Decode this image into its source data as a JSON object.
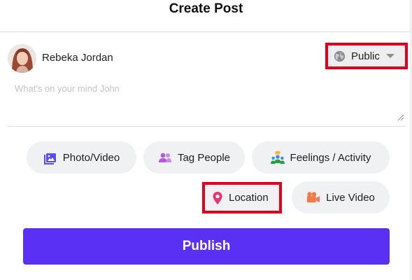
{
  "header": {
    "title": "Create Post"
  },
  "user": {
    "name": "Rebeka Jordan",
    "avatar_icon": "user-avatar"
  },
  "privacy": {
    "label": "Public",
    "icon": "globe-icon",
    "caret_icon": "caret-down-icon"
  },
  "composer": {
    "placeholder": "What's on your mind John",
    "value": ""
  },
  "actions": [
    {
      "label": "Photo/Video",
      "icon": "photo-video-icon",
      "color": "#5b4af5"
    },
    {
      "label": "Tag People",
      "icon": "tag-people-icon",
      "color": "#b45ad7"
    },
    {
      "label": "Feelings / Activity",
      "icon": "feelings-activity-icon",
      "color": "#2a9d4b"
    },
    {
      "label": "Location",
      "icon": "location-pin-icon",
      "color": "#e8336f"
    },
    {
      "label": "Live Video",
      "icon": "live-video-icon",
      "color": "#f07a4a"
    }
  ],
  "publish": {
    "label": "Publish"
  },
  "colors": {
    "accent": "#5a30f4",
    "highlight": "#e4001b",
    "chip_bg": "#f0f1f2"
  }
}
